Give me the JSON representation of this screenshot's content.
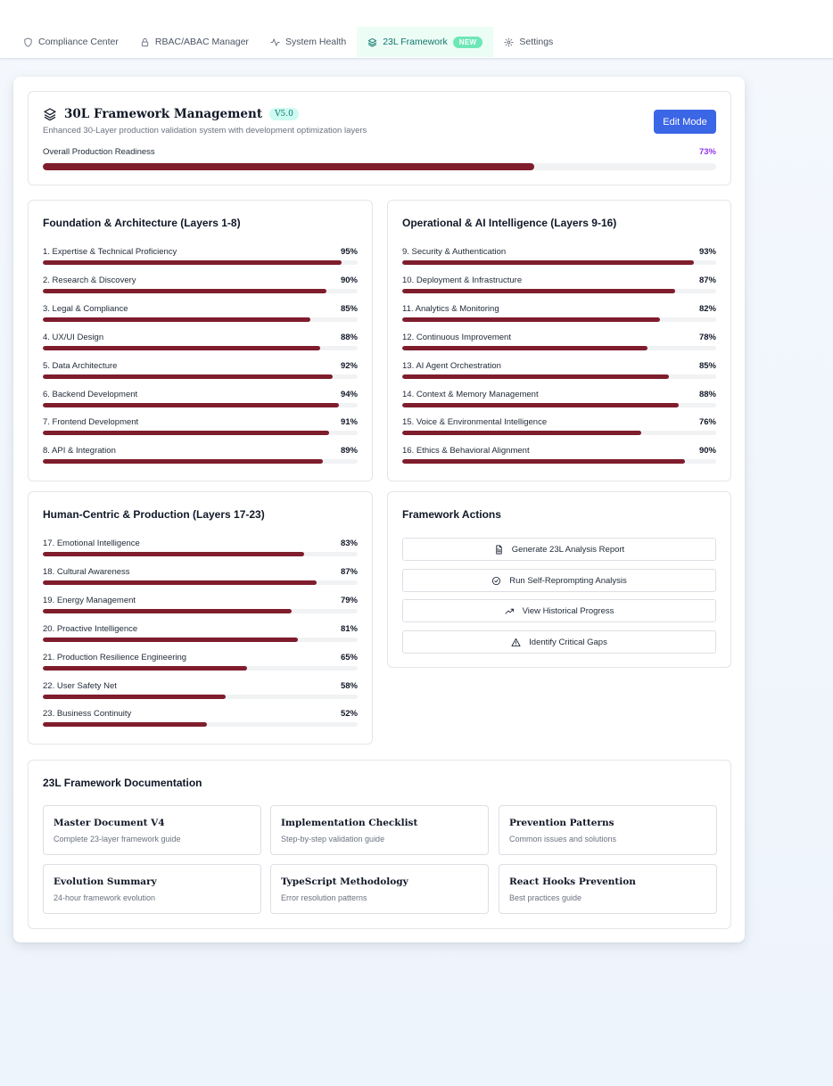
{
  "nav": {
    "items": [
      {
        "label": "Compliance Center",
        "icon": "shield-icon"
      },
      {
        "label": "RBAC/ABAC Manager",
        "icon": "lock-icon"
      },
      {
        "label": "System Health",
        "icon": "activity-icon"
      },
      {
        "label": "23L Framework",
        "icon": "layers-icon",
        "badge": "NEW",
        "active": true
      },
      {
        "label": "Settings",
        "icon": "gear-icon"
      }
    ]
  },
  "header": {
    "title": "30L Framework Management",
    "version": "V5.0",
    "subtitle": "Enhanced 30-Layer production validation system with development optimization layers",
    "edit_label": "Edit Mode",
    "readiness_label": "Overall Production Readiness",
    "readiness_pct": "73%",
    "readiness_value": 73
  },
  "foundation": {
    "title": "Foundation & Architecture (Layers 1-8)",
    "layers": [
      {
        "name": "1. Expertise & Technical Proficiency",
        "pct": "95%",
        "value": 95
      },
      {
        "name": "2. Research & Discovery",
        "pct": "90%",
        "value": 90
      },
      {
        "name": "3. Legal & Compliance",
        "pct": "85%",
        "value": 85
      },
      {
        "name": "4. UX/UI Design",
        "pct": "88%",
        "value": 88
      },
      {
        "name": "5. Data Architecture",
        "pct": "92%",
        "value": 92
      },
      {
        "name": "6. Backend Development",
        "pct": "94%",
        "value": 94
      },
      {
        "name": "7. Frontend Development",
        "pct": "91%",
        "value": 91
      },
      {
        "name": "8. API & Integration",
        "pct": "89%",
        "value": 89
      }
    ]
  },
  "operational": {
    "title": "Operational & AI Intelligence (Layers 9-16)",
    "layers": [
      {
        "name": "9. Security & Authentication",
        "pct": "93%",
        "value": 93
      },
      {
        "name": "10. Deployment & Infrastructure",
        "pct": "87%",
        "value": 87
      },
      {
        "name": "11. Analytics & Monitoring",
        "pct": "82%",
        "value": 82
      },
      {
        "name": "12. Continuous Improvement",
        "pct": "78%",
        "value": 78
      },
      {
        "name": "13. AI Agent Orchestration",
        "pct": "85%",
        "value": 85
      },
      {
        "name": "14. Context & Memory Management",
        "pct": "88%",
        "value": 88
      },
      {
        "name": "15. Voice & Environmental Intelligence",
        "pct": "76%",
        "value": 76
      },
      {
        "name": "16. Ethics & Behavioral Alignment",
        "pct": "90%",
        "value": 90
      }
    ]
  },
  "human": {
    "title": "Human-Centric & Production (Layers 17-23)",
    "layers": [
      {
        "name": "17. Emotional Intelligence",
        "pct": "83%",
        "value": 83
      },
      {
        "name": "18. Cultural Awareness",
        "pct": "87%",
        "value": 87
      },
      {
        "name": "19. Energy Management",
        "pct": "79%",
        "value": 79
      },
      {
        "name": "20. Proactive Intelligence",
        "pct": "81%",
        "value": 81
      },
      {
        "name": "21. Production Resilience Engineering",
        "pct": "65%",
        "value": 65
      },
      {
        "name": "22. User Safety Net",
        "pct": "58%",
        "value": 58
      },
      {
        "name": "23. Business Continuity",
        "pct": "52%",
        "value": 52
      }
    ]
  },
  "actions": {
    "title": "Framework Actions",
    "buttons": [
      {
        "label": "Generate 23L Analysis Report",
        "icon": "file-text-icon"
      },
      {
        "label": "Run Self-Reprompting Analysis",
        "icon": "check-circle-icon"
      },
      {
        "label": "View Historical Progress",
        "icon": "trending-up-icon"
      },
      {
        "label": "Identify Critical Gaps",
        "icon": "alert-triangle-icon"
      }
    ]
  },
  "docs": {
    "title": "23L Framework Documentation",
    "items": [
      {
        "title": "Master Document V4",
        "desc": "Complete 23-layer framework guide"
      },
      {
        "title": "Implementation Checklist",
        "desc": "Step-by-step validation guide"
      },
      {
        "title": "Prevention Patterns",
        "desc": "Common issues and solutions"
      },
      {
        "title": "Evolution Summary",
        "desc": "24-hour framework evolution"
      },
      {
        "title": "TypeScript Methodology",
        "desc": "Error resolution patterns"
      },
      {
        "title": "React Hooks Prevention",
        "desc": "Best practices guide"
      }
    ]
  },
  "colors": {
    "bar_fill": "#7f1d2d",
    "accent_blue": "#3b66e6",
    "readiness_purple": "#9333ea",
    "active_tab_bg": "#ecfdf5",
    "badge_green": "#6ee7b7"
  }
}
